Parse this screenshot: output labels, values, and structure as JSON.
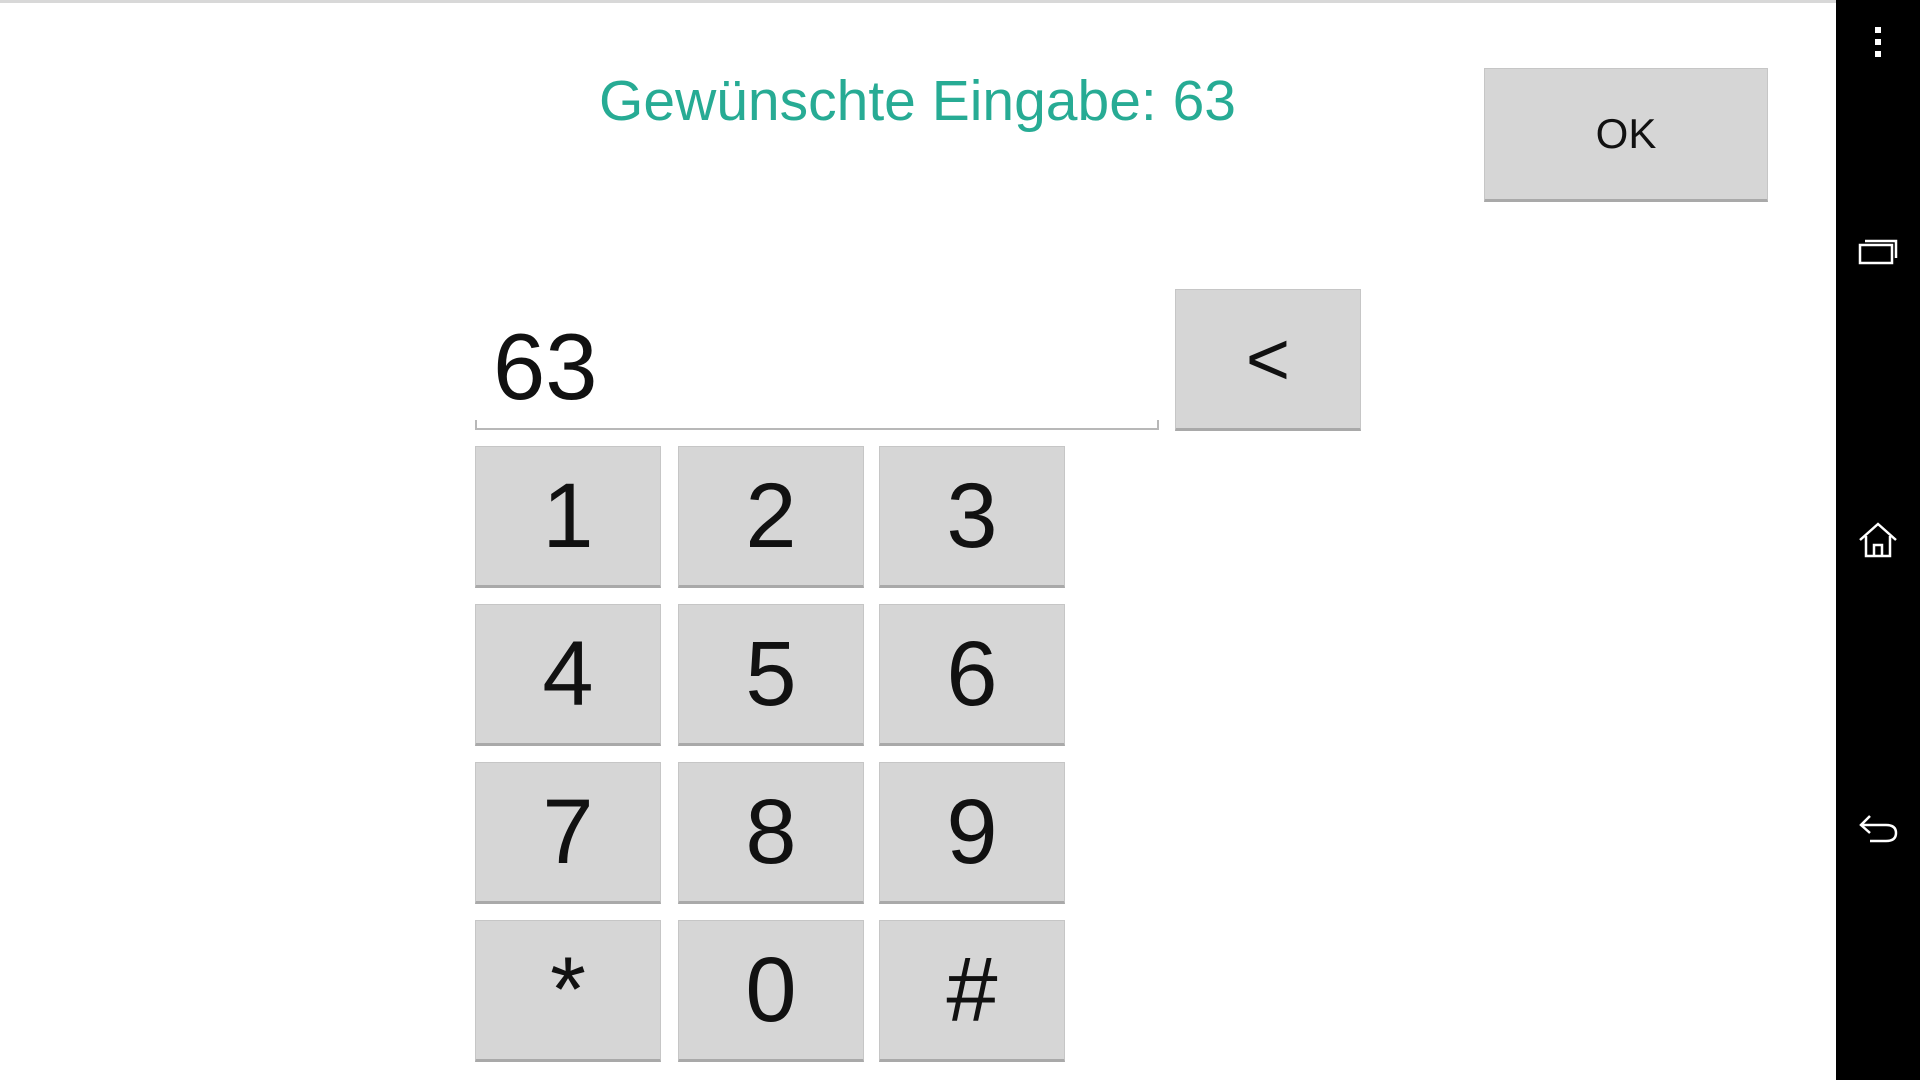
{
  "prompt": {
    "text": "Gewünschte Eingabe: 63",
    "color": "#27ab94"
  },
  "ok_button": {
    "label": "OK"
  },
  "backspace_button": {
    "label": "<"
  },
  "input": {
    "value": "63"
  },
  "keypad": {
    "keys": [
      "1",
      "2",
      "3",
      "4",
      "5",
      "6",
      "7",
      "8",
      "9",
      "*",
      "0",
      "#"
    ]
  },
  "nav_bar": {
    "icons": [
      "menu-icon",
      "recents-icon",
      "home-icon",
      "back-icon"
    ]
  },
  "colors": {
    "button_bg": "#d6d6d6",
    "nav_bg": "#000000",
    "text": "#111111"
  }
}
